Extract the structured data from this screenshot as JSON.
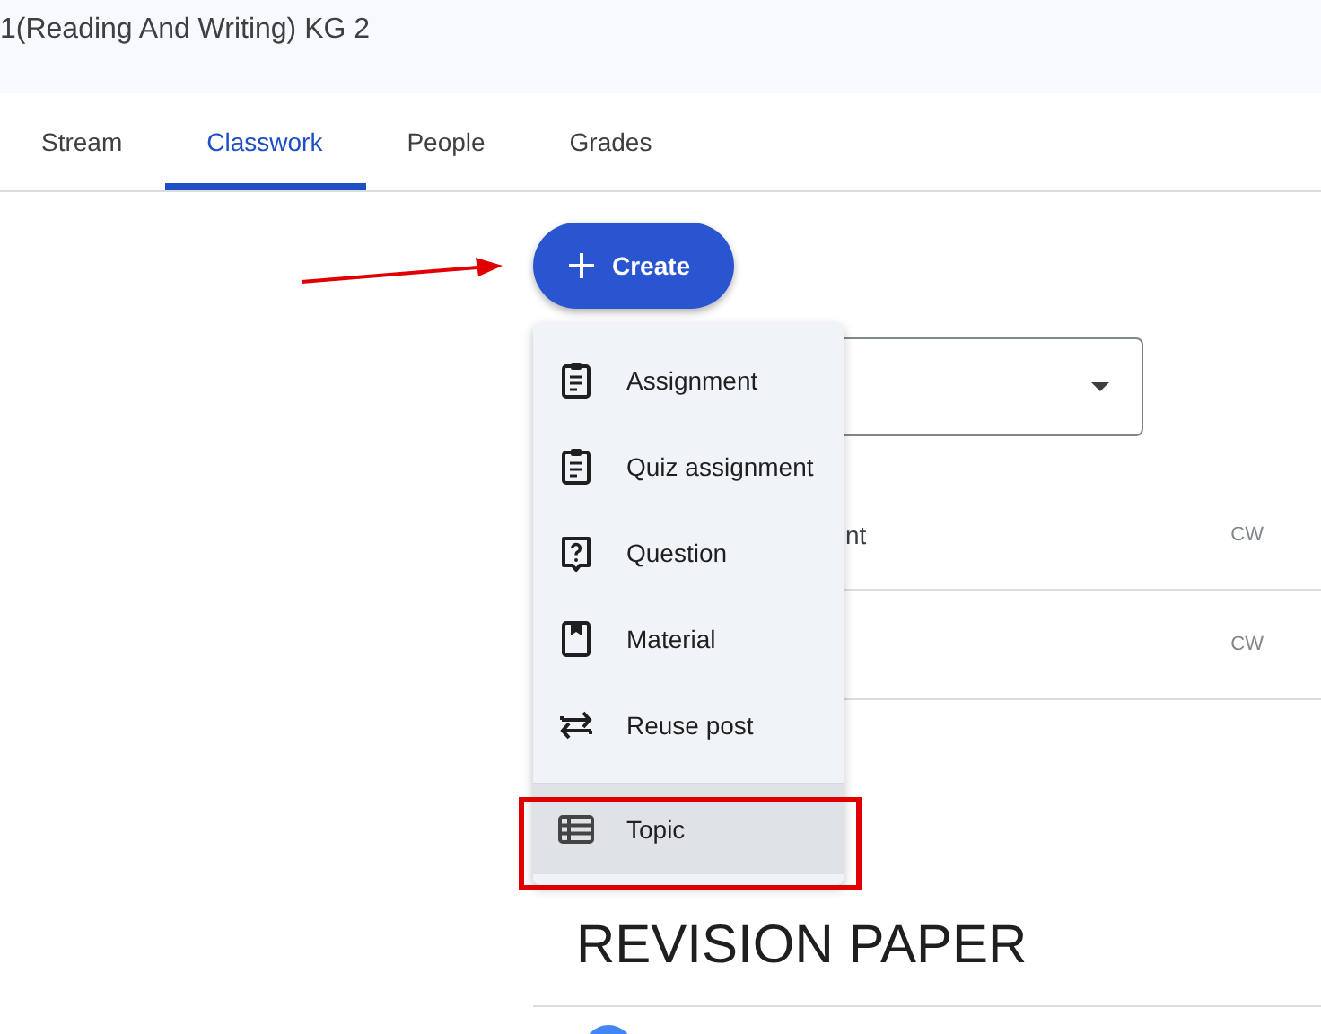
{
  "class_title": "1(Reading And Writing) KG 2",
  "tabs": [
    {
      "label": "Stream",
      "selected": false
    },
    {
      "label": "Classwork",
      "selected": true
    },
    {
      "label": "People",
      "selected": false
    },
    {
      "label": "Grades",
      "selected": false
    }
  ],
  "create_button": {
    "label": "Create"
  },
  "rows": [
    {
      "title": "nt",
      "tag": "CW"
    },
    {
      "tag": "CW"
    }
  ],
  "topic_heading": "REVISION PAPER",
  "menu": {
    "items": [
      {
        "kind": "assignment",
        "label": "Assignment",
        "selected": false
      },
      {
        "kind": "quiz",
        "label": "Quiz assignment",
        "selected": false
      },
      {
        "kind": "question",
        "label": "Question",
        "selected": false
      },
      {
        "kind": "material",
        "label": "Material",
        "selected": false
      },
      {
        "kind": "reuse",
        "label": "Reuse post",
        "selected": false
      },
      {
        "kind": "topic",
        "label": "Topic",
        "selected": true
      }
    ]
  }
}
